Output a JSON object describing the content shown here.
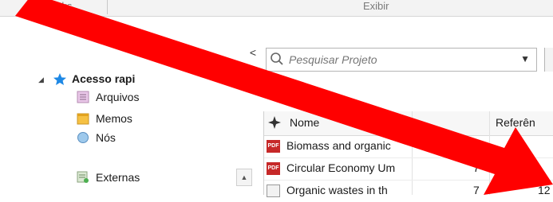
{
  "ribbon": {
    "groups": [
      "Links",
      "Exibir"
    ]
  },
  "nav": {
    "collapse_glyph": "<",
    "quick_access": "Acesso rapi",
    "items": [
      "Arquivos",
      "Memos",
      "Nós",
      "Externas"
    ]
  },
  "search": {
    "placeholder": "Pesquisar Projeto"
  },
  "table": {
    "columns": [
      "Nome",
      "Referên"
    ],
    "rows": [
      {
        "name": "Biomass and organic",
        "count": "",
        "ref": ""
      },
      {
        "name": "Circular Economy Um",
        "count": "7",
        "ref": ""
      },
      {
        "name": "Organic wastes in th",
        "count": "7",
        "ref": "12"
      }
    ]
  },
  "colors": {
    "arrow": "#ff0000",
    "accent": "#1e88e5",
    "pdf": "#c62828"
  }
}
